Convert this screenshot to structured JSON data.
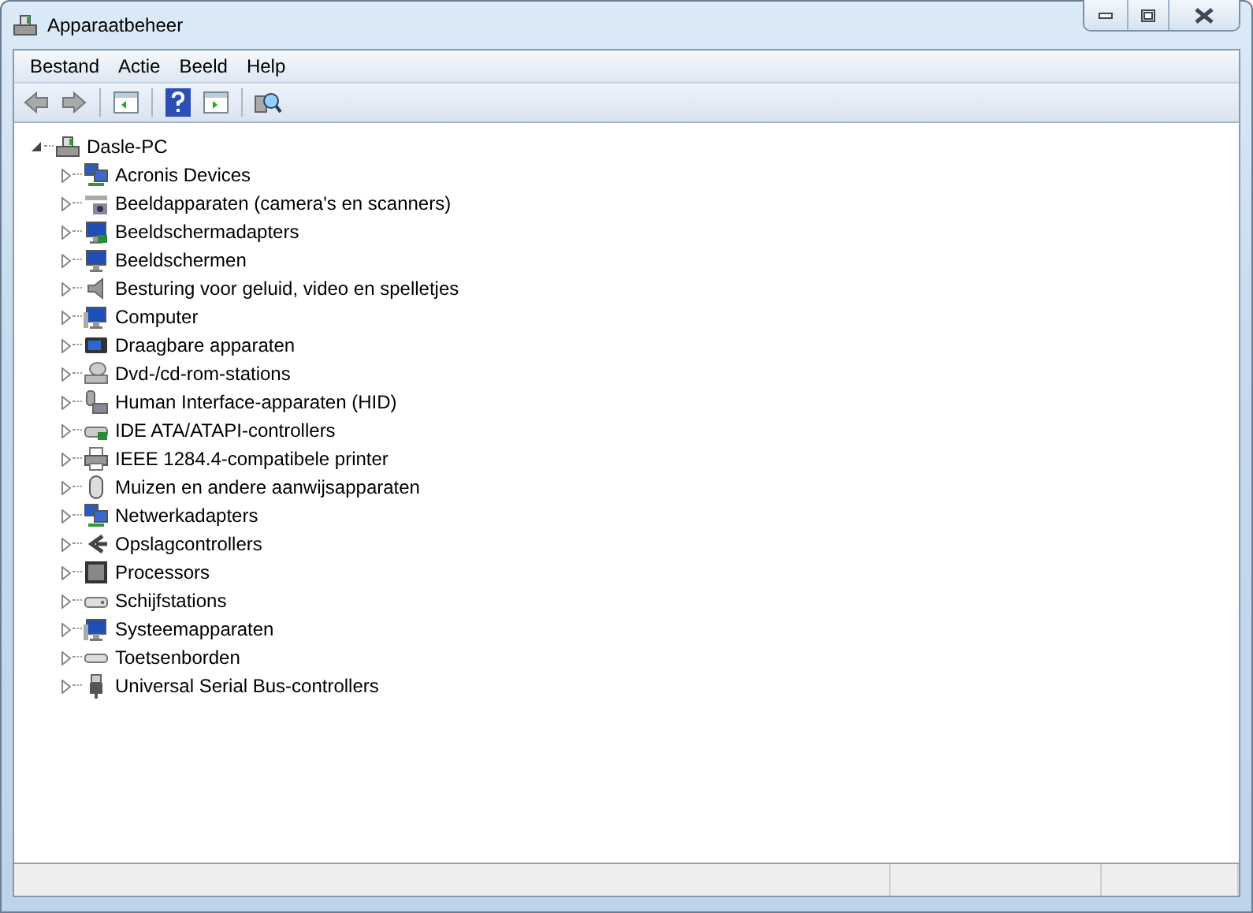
{
  "window": {
    "title": "Apparaatbeheer"
  },
  "menu": [
    "Bestand",
    "Actie",
    "Beeld",
    "Help"
  ],
  "tree": {
    "label": "Dasle-PC",
    "expanded": true,
    "children": [
      {
        "label": "Acronis Devices",
        "expanded": false
      },
      {
        "label": "Beeldapparaten (camera's en scanners)",
        "expanded": false
      },
      {
        "label": "Beeldschermadapters",
        "expanded": false
      },
      {
        "label": "Beeldschermen",
        "expanded": false
      },
      {
        "label": "Besturing voor geluid, video en spelletjes",
        "expanded": false
      },
      {
        "label": "Computer",
        "expanded": false
      },
      {
        "label": "Draagbare apparaten",
        "expanded": false
      },
      {
        "label": "Dvd-/cd-rom-stations",
        "expanded": false
      },
      {
        "label": "Human Interface-apparaten (HID)",
        "expanded": false
      },
      {
        "label": "IDE ATA/ATAPI-controllers",
        "expanded": false
      },
      {
        "label": "IEEE 1284.4-compatibele printer",
        "expanded": false
      },
      {
        "label": "Muizen en andere aanwijsapparaten",
        "expanded": false
      },
      {
        "label": "Netwerkadapters",
        "expanded": false
      },
      {
        "label": "Opslagcontrollers",
        "expanded": false
      },
      {
        "label": "Processors",
        "expanded": false
      },
      {
        "label": "Schijfstations",
        "expanded": false
      },
      {
        "label": "Systeemapparaten",
        "expanded": false
      },
      {
        "label": "Toetsenborden",
        "expanded": false
      },
      {
        "label": "Universal Serial Bus-controllers",
        "expanded": false
      }
    ]
  }
}
